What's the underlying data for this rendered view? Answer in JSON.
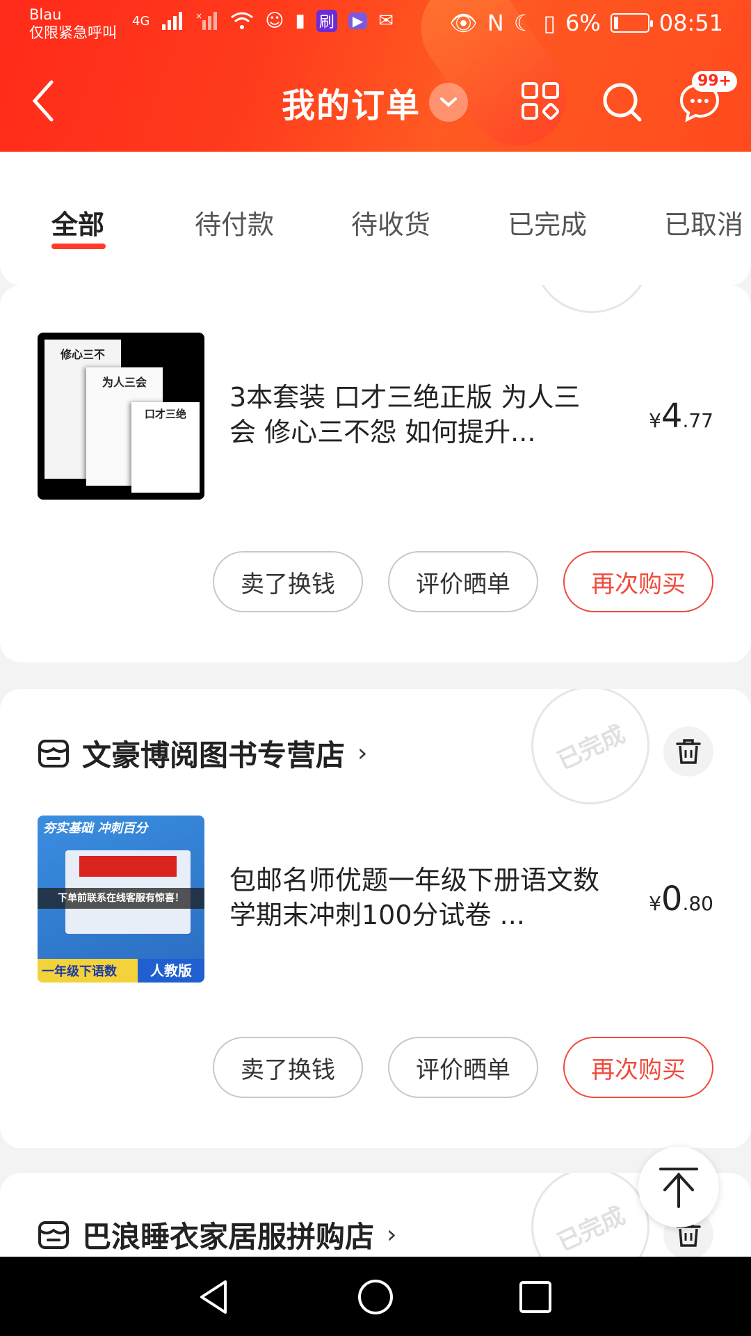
{
  "status_bar": {
    "carrier": "Blau",
    "emergency": "仅限紧急呼叫",
    "signal_4g": "4G",
    "icon_shua": "刷",
    "battery_pct": "6%",
    "time": "08:51"
  },
  "header": {
    "title": "我的订单",
    "message_badge": "99+"
  },
  "tabs": [
    {
      "label": "全部"
    },
    {
      "label": "待付款"
    },
    {
      "label": "待收货"
    },
    {
      "label": "已完成"
    },
    {
      "label": "已取消"
    }
  ],
  "orders": [
    {
      "product_title": "3本套装 口才三绝正版 为人三会 修心三不怨 如何提升...",
      "price_symbol": "¥",
      "price_int": "4",
      "price_dec": ".77",
      "thumb_text": [
        "修心三不",
        "为人三会",
        "口才三绝"
      ],
      "buttons": [
        "卖了换钱",
        "评价晒单",
        "再次购买"
      ]
    },
    {
      "shop_name": "文豪博阅图书专营店",
      "status_stamp": "已完成",
      "product_title": "包邮名师优题一年级下册语文数学期末冲刺100分试卷 ...",
      "price_symbol": "¥",
      "price_int": "0",
      "price_dec": ".80",
      "thumb_text": [
        "夯实基础 冲刺百分",
        "下单前联系在线客服有惊喜！",
        "一年级下语数",
        "人教版"
      ],
      "buttons": [
        "卖了换钱",
        "评价晒单",
        "再次购买"
      ]
    },
    {
      "shop_name": "巴浪睡衣家居服拼购店",
      "status_stamp": "已完成"
    }
  ],
  "colors": {
    "brand_red": "#ff3a2a",
    "button_red": "#f04a3c"
  }
}
